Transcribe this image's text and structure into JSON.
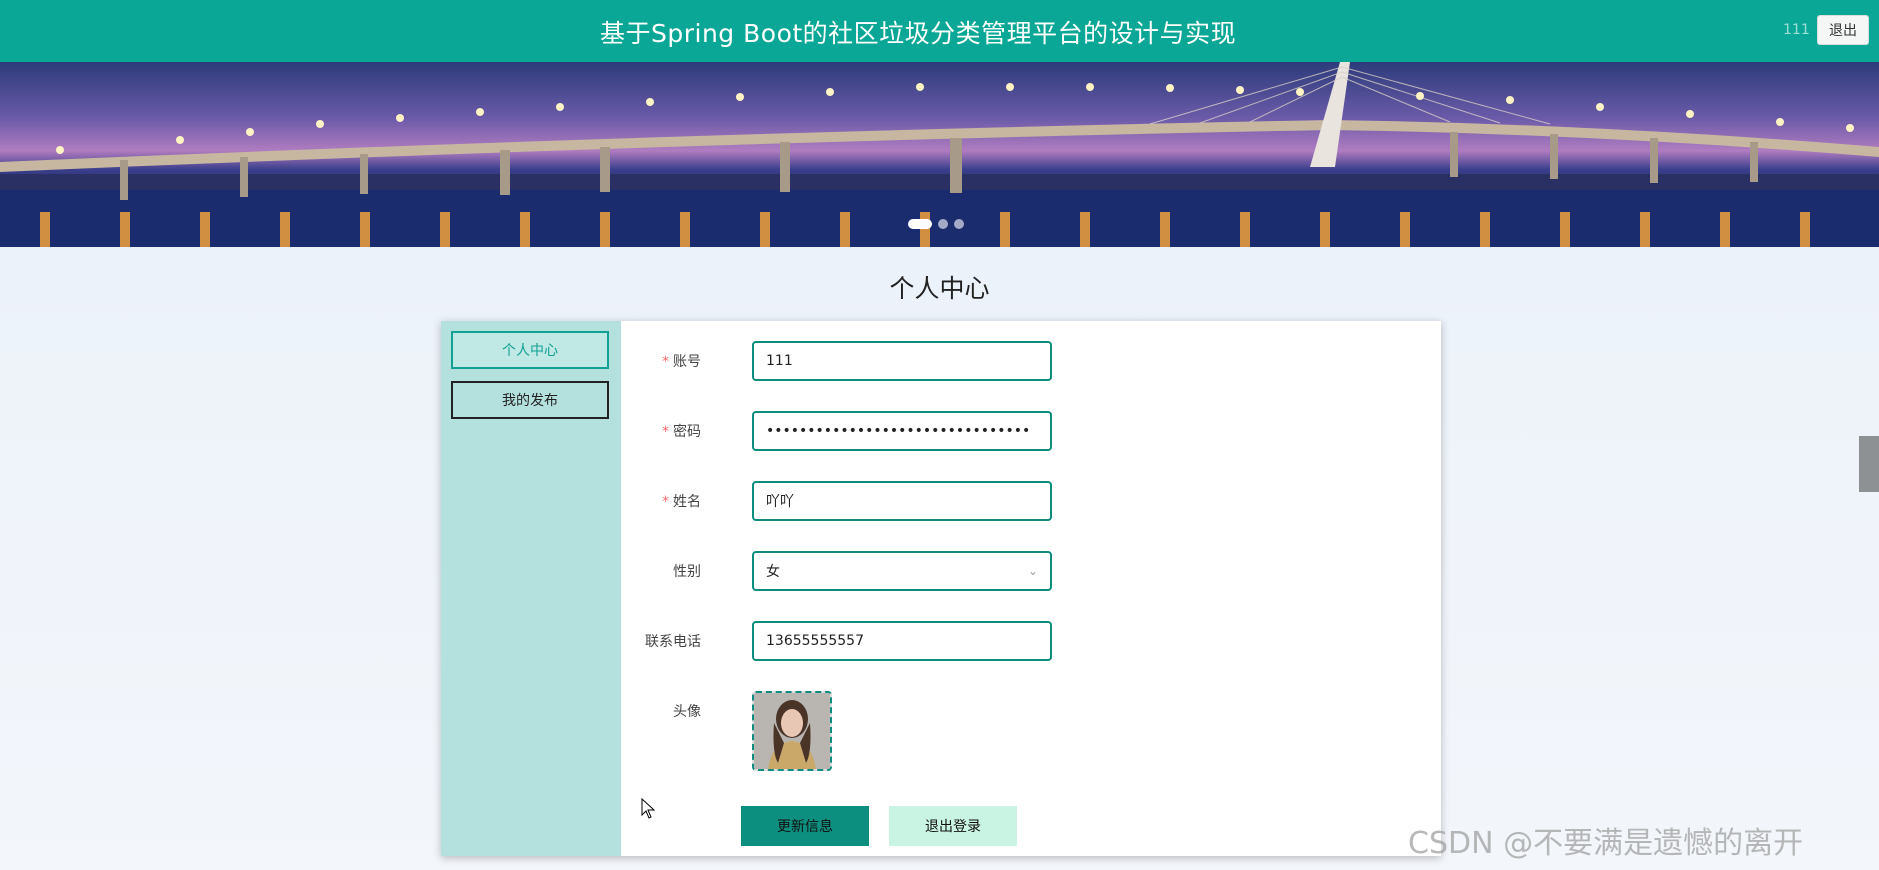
{
  "header": {
    "title": "基于Spring Boot的社区垃圾分类管理平台的设计与实现",
    "username": "111",
    "logout_label": "退出"
  },
  "banner": {
    "slides": 3,
    "active_slide": 1
  },
  "page": {
    "heading": "个人中心"
  },
  "sidebar": {
    "items": [
      {
        "label": "个人中心",
        "active": true
      },
      {
        "label": "我的发布",
        "active": false
      }
    ]
  },
  "form": {
    "account": {
      "label": "账号",
      "required": true,
      "value": "111"
    },
    "password": {
      "label": "密码",
      "required": true,
      "value": "••••••••••••••••••••••••••••••••"
    },
    "name": {
      "label": "姓名",
      "required": true,
      "value": "吖吖"
    },
    "gender": {
      "label": "性别",
      "required": false,
      "value": "女"
    },
    "phone": {
      "label": "联系电话",
      "required": false,
      "value": "13655555557"
    },
    "avatar": {
      "label": "头像"
    },
    "required_mark": "*"
  },
  "actions": {
    "update_label": "更新信息",
    "logout_label": "退出登录"
  },
  "watermark": "CSDN @不要满是遗憾的离开",
  "colors": {
    "header": "#0aa796",
    "accent": "#0e8c7e",
    "sidebar": "#b4e1de",
    "update_button": "#0d8f7f",
    "logout_button": "#c9f3e2"
  },
  "icons": {
    "select_arrow": "chevron-down-icon",
    "cursor": "mouse-pointer-icon"
  }
}
